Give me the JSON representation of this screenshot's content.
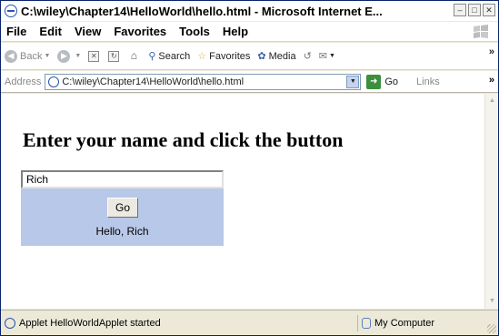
{
  "window": {
    "title": "C:\\wiley\\Chapter14\\HelloWorld\\hello.html - Microsoft Internet E...",
    "controls": [
      "minimize",
      "maximize",
      "close"
    ]
  },
  "menu": {
    "items": [
      {
        "label": "File"
      },
      {
        "label": "Edit"
      },
      {
        "label": "View"
      },
      {
        "label": "Favorites"
      },
      {
        "label": "Tools"
      },
      {
        "label": "Help"
      }
    ]
  },
  "toolbar": {
    "back_label": "Back",
    "search_label": "Search",
    "favorites_label": "Favorites",
    "media_label": "Media",
    "overflow": "»"
  },
  "address": {
    "label": "Address",
    "url": "C:\\wiley\\Chapter14\\HelloWorld\\hello.html",
    "go_label": "Go",
    "links_label": "Links",
    "overflow": "»"
  },
  "page": {
    "heading": "Enter your name and click the button",
    "applet": {
      "input_value": "Rich",
      "button_label": "Go",
      "message": "Hello, Rich",
      "background": "#b8c8e8"
    }
  },
  "status": {
    "text": "Applet HelloWorldApplet started",
    "zone": "My Computer"
  }
}
